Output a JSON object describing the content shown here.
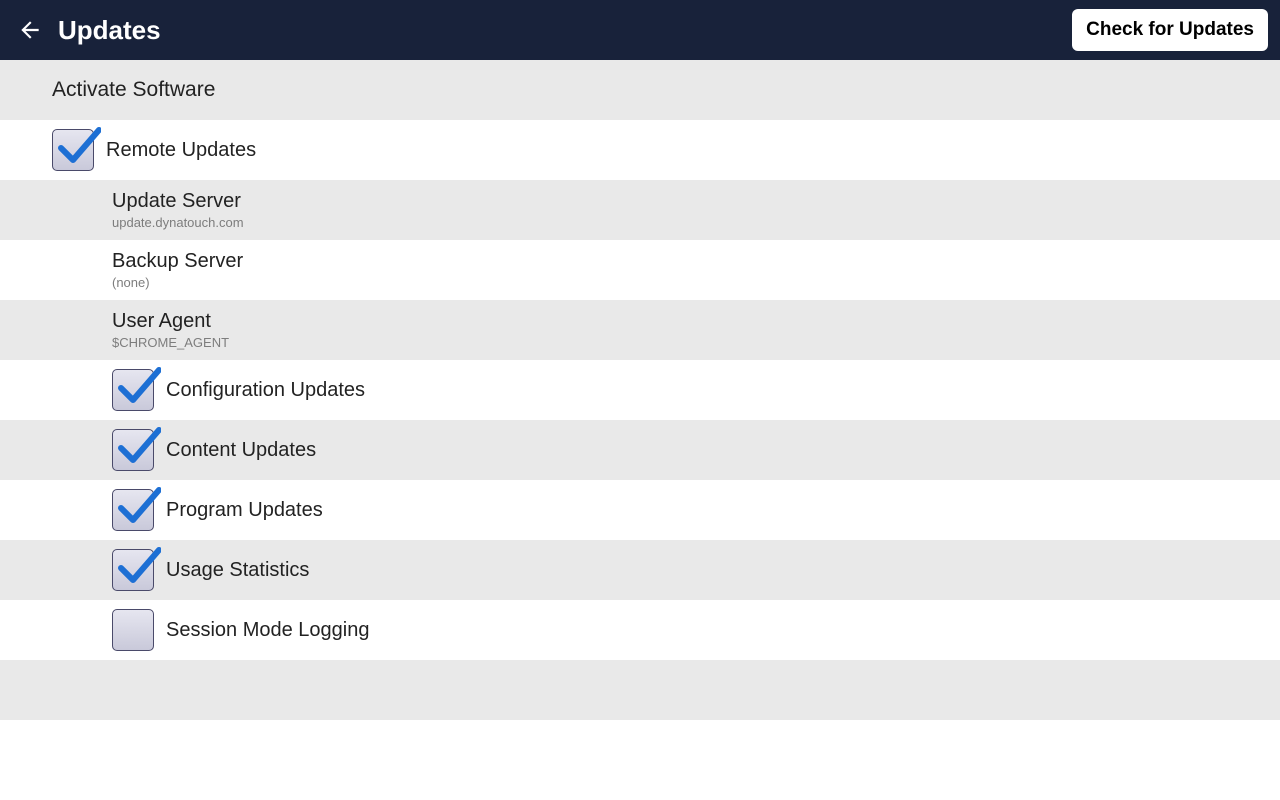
{
  "header": {
    "title": "Updates",
    "check_button": "Check for Updates"
  },
  "sections": {
    "activate": "Activate Software"
  },
  "remote_updates": {
    "label": "Remote Updates",
    "checked": true
  },
  "fields": {
    "update_server": {
      "label": "Update Server",
      "value": "update.dynatouch.com"
    },
    "backup_server": {
      "label": "Backup Server",
      "value": "(none)"
    },
    "user_agent": {
      "label": "User Agent",
      "value": "$CHROME_AGENT"
    }
  },
  "options": [
    {
      "label": "Configuration Updates",
      "checked": true
    },
    {
      "label": "Content Updates",
      "checked": true
    },
    {
      "label": "Program Updates",
      "checked": true
    },
    {
      "label": "Usage Statistics",
      "checked": true
    },
    {
      "label": "Session Mode Logging",
      "checked": false
    }
  ]
}
